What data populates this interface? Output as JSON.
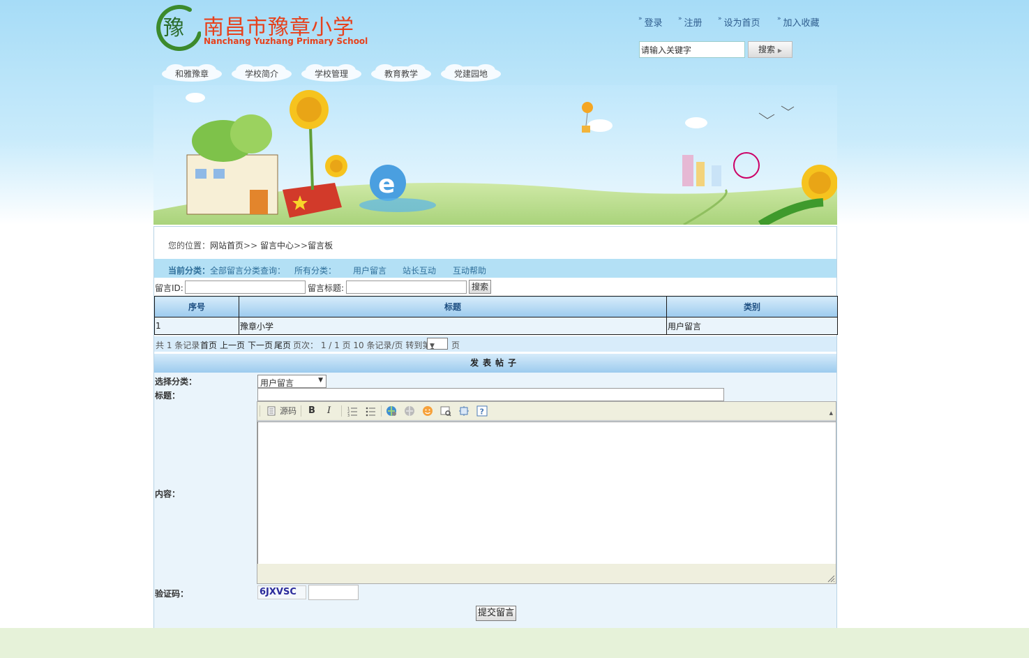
{
  "site": {
    "logo_char": "豫",
    "logo_cn": "南昌市豫章小学",
    "logo_en": "Nanchang Yuzhang Primary School"
  },
  "top_links": [
    "登录",
    "注册",
    "设为首页",
    "加入收藏"
  ],
  "search": {
    "value": "请输入关键字",
    "button": "搜索"
  },
  "nav": [
    "和雅豫章",
    "学校简介",
    "学校管理",
    "教育教学",
    "党建园地"
  ],
  "breadcrumb": {
    "prefix": "您的位置：",
    "home": "网站首页",
    "sep1": ">> ",
    "center": "留言中心",
    "sep2": ">>",
    "board": "留言板"
  },
  "category_bar": {
    "label": "当前分类：",
    "query": "全部留言分类查询：",
    "all": "所有分类：",
    "items": [
      "用户留言",
      "站长互动",
      "互动帮助"
    ]
  },
  "filter": {
    "id_label": "留言ID:",
    "title_label": "留言标题:",
    "button": "搜索"
  },
  "table": {
    "headers": [
      "序号",
      "标题",
      "类别"
    ],
    "rows": [
      [
        "1",
        "豫章小学",
        "用户留言"
      ]
    ]
  },
  "pager": {
    "total": "共 1 条记录",
    "first": "首页",
    "prev": "上一页",
    "next": "下一页",
    "last": "尾页",
    "pages": "页次： 1 / 1 页 10 条记录/页 转到第",
    "select": "1",
    "suffix": "页"
  },
  "post_form": {
    "heading": "发表帖子",
    "category_label": "选择分类：",
    "category_value": "用户留言",
    "title_label": "标题：",
    "content_label": "内容：",
    "source_label": "源码",
    "captcha_label": "验证码：",
    "captcha_text": "6JXVSC",
    "submit": "提交留言"
  },
  "colors": {
    "accent": "#e7411c",
    "link": "#2f5d8e",
    "bar": "#b3e0f5",
    "table_head": "#9ccbee"
  }
}
